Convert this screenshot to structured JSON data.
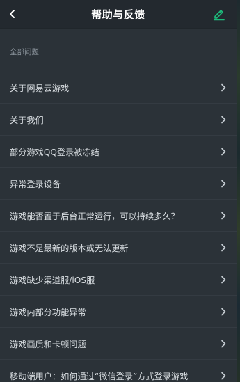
{
  "header": {
    "title": "帮助与反馈",
    "back_icon": "chevron-left-icon",
    "edit_icon": "pencil-icon",
    "accent_color": "#1db97a"
  },
  "section": {
    "title": "全部问题"
  },
  "faq_items": [
    {
      "label": "关于网易云游戏"
    },
    {
      "label": "关于我们"
    },
    {
      "label": "部分游戏QQ登录被冻结"
    },
    {
      "label": "异常登录设备"
    },
    {
      "label": "游戏能否置于后台正常运行，可以持续多久？"
    },
    {
      "label": "游戏不是最新的版本或无法更新"
    },
    {
      "label": "游戏缺少渠道服/iOS服"
    },
    {
      "label": "游戏内部分功能异常"
    },
    {
      "label": "游戏画质和卡顿问题"
    },
    {
      "label": "移动端用户：如何通过“微信登录”方式登录游戏"
    }
  ]
}
